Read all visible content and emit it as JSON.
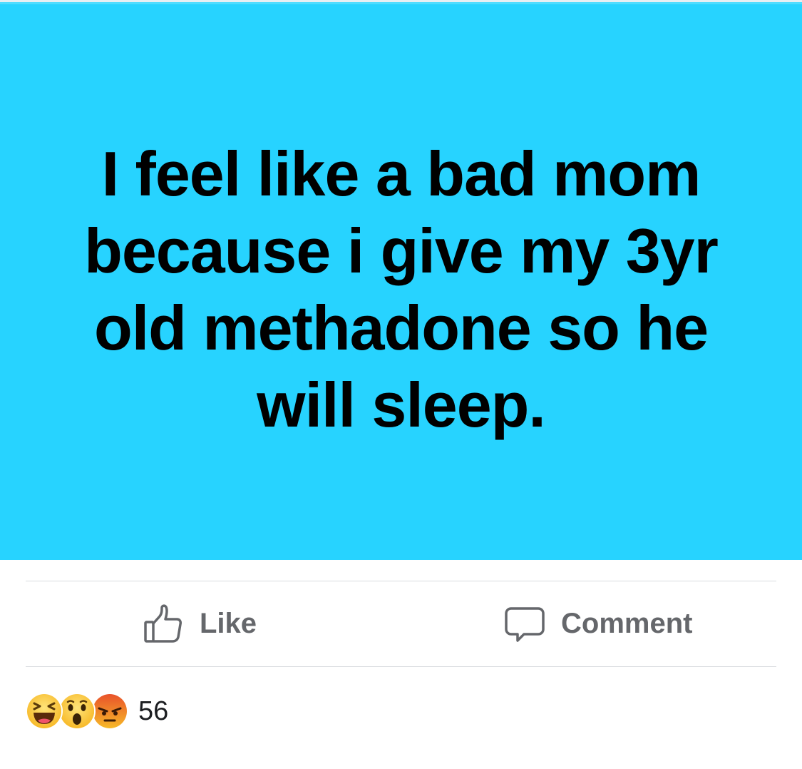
{
  "post": {
    "status_text": "I feel like a bad mom because i give my 3yr old methadone so he will sleep.",
    "background_color": "#27d3ff"
  },
  "actions": {
    "like_label": "Like",
    "comment_label": "Comment",
    "like_icon": "thumbs-up-icon",
    "comment_icon": "speech-bubble-icon"
  },
  "reactions": {
    "types": [
      "haha-reaction-icon",
      "wow-reaction-icon",
      "angry-reaction-icon"
    ],
    "count": "56"
  }
}
